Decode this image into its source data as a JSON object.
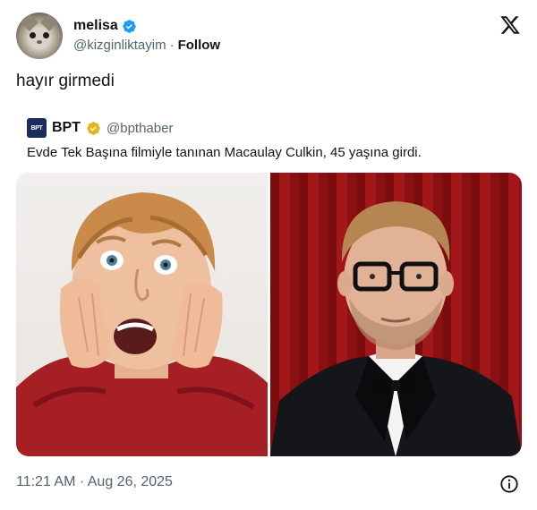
{
  "author": {
    "display_name": "melisa",
    "handle": "@kizginliktayim",
    "separator": "·",
    "follow_label": "Follow"
  },
  "tweet": {
    "text": "hayır girmedi",
    "timestamp": "11:21 AM · Aug 26, 2025"
  },
  "quoted": {
    "logo_text": "BPT",
    "display_name": "BPT",
    "handle": "@bpthaber",
    "text": "Evde Tek Başına filmiyle tanınan Macaulay Culkin, 45 yaşına girdi."
  },
  "colors": {
    "verified_blue": "#1d9bf0",
    "verified_gold": "#e2b719",
    "secondary_text": "#536471"
  },
  "icons": [
    "verified-icon",
    "x-logo-icon",
    "gold-verified-icon",
    "info-icon"
  ]
}
